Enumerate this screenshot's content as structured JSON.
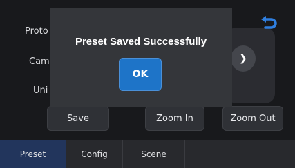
{
  "background_rows": [
    {
      "label": "Proto"
    },
    {
      "label": "Cam"
    },
    {
      "label": "Uni"
    }
  ],
  "buttons": {
    "save": "Save",
    "zoom_in": "Zoom In",
    "zoom_out": "Zoom Out"
  },
  "tabs": [
    {
      "label": "Preset",
      "active": true
    },
    {
      "label": "Config",
      "active": false
    },
    {
      "label": "Scene",
      "active": false
    },
    {
      "label": "",
      "active": false
    },
    {
      "label": "",
      "active": false
    }
  ],
  "dialog": {
    "message": "Preset Saved Successfully",
    "ok_label": "OK"
  },
  "icons": {
    "back": "back-arrow-icon",
    "arrow": "chevron-right-icon"
  },
  "colors": {
    "accent": "#1e74c8",
    "active_tab": "#22355c",
    "back_icon": "#2f7fe0"
  }
}
